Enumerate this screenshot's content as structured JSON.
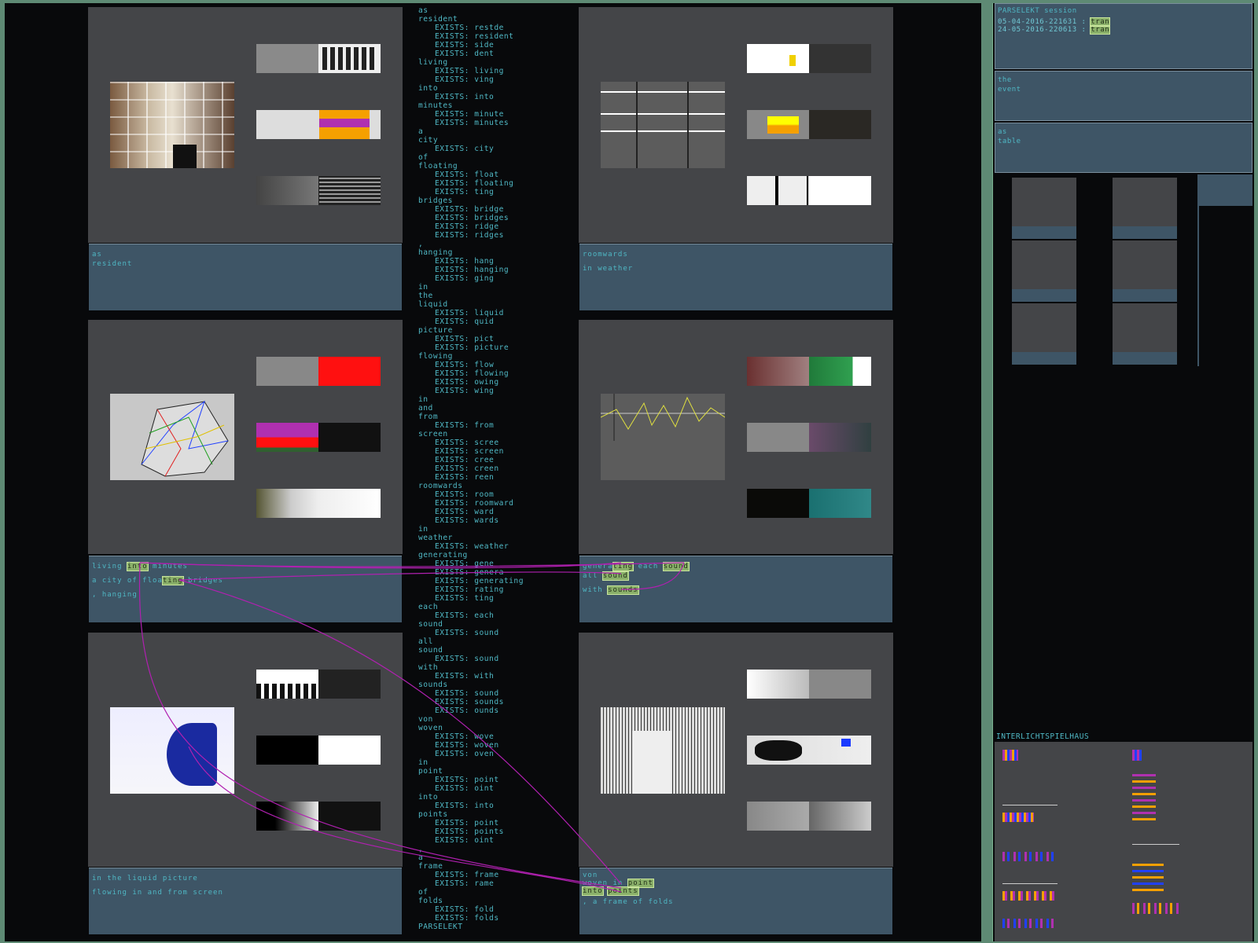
{
  "captions": {
    "p1": [
      "as",
      "resident"
    ],
    "p2": [
      "roomwards",
      "",
      "in weather"
    ],
    "p3": {
      "line1": [
        "living ",
        "into",
        " minutes"
      ],
      "line2": [
        "a city of floa",
        "ting",
        " bridges"
      ],
      "line3": ", hanging"
    },
    "p4": {
      "line1": [
        "genera",
        "ting",
        " each ",
        "sound"
      ],
      "line2": [
        "all ",
        "sound"
      ],
      "line3": [
        "with ",
        "sounds"
      ]
    },
    "p5": [
      "in the liquid picture",
      "flowing in and from screen"
    ],
    "p6": {
      "line1": [
        "von"
      ],
      "line2": [
        "woven in ",
        "point"
      ],
      "line3": [
        "into",
        " ",
        "points"
      ],
      "line4": ", a frame of folds"
    }
  },
  "wordlist": [
    [
      "as",
      []
    ],
    [
      "resident",
      [
        "restde",
        "resident",
        "side",
        "dent"
      ]
    ],
    [
      "living",
      [
        "living",
        "ving"
      ]
    ],
    [
      "into",
      [
        "into"
      ]
    ],
    [
      "minutes",
      [
        "minute",
        "minutes"
      ]
    ],
    [
      "a",
      []
    ],
    [
      "city",
      [
        "city"
      ]
    ],
    [
      "of",
      []
    ],
    [
      "floating",
      [
        "float",
        "floating",
        "ting"
      ]
    ],
    [
      "bridges",
      [
        "bridge",
        "bridges",
        "ridge",
        "ridges"
      ]
    ],
    [
      ",",
      []
    ],
    [
      "hanging",
      [
        "hang",
        "hanging",
        "ging"
      ]
    ],
    [
      "in",
      []
    ],
    [
      "the",
      []
    ],
    [
      "liquid",
      [
        "liquid",
        "quid"
      ]
    ],
    [
      "picture",
      [
        "pict",
        "picture"
      ]
    ],
    [
      "flowing",
      [
        "flow",
        "flowing",
        "owing",
        "wing"
      ]
    ],
    [
      "in",
      []
    ],
    [
      "and",
      []
    ],
    [
      "from",
      [
        "from"
      ]
    ],
    [
      "screen",
      [
        "scree",
        "screen",
        "cree",
        "creen",
        "reen"
      ]
    ],
    [
      "roomwards",
      [
        "room",
        "roomward",
        "ward",
        "wards"
      ]
    ],
    [
      "in",
      []
    ],
    [
      "weather",
      [
        "weather"
      ]
    ],
    [
      "generating",
      [
        "gene",
        "genera",
        "generating",
        "rating",
        "ting"
      ]
    ],
    [
      "each",
      [
        "each"
      ]
    ],
    [
      "sound",
      [
        "sound"
      ]
    ],
    [
      "all",
      []
    ],
    [
      "sound",
      [
        "sound"
      ]
    ],
    [
      "with",
      [
        "with"
      ]
    ],
    [
      "sounds",
      [
        "sound",
        "sounds",
        "ounds"
      ]
    ],
    [
      "von",
      []
    ],
    [
      "woven",
      [
        "wove",
        "woven",
        "oven"
      ]
    ],
    [
      "in",
      []
    ],
    [
      "point",
      [
        "point",
        "oint"
      ]
    ],
    [
      "into",
      [
        "into"
      ]
    ],
    [
      "points",
      [
        "point",
        "points",
        "oint"
      ]
    ],
    [
      ",",
      []
    ],
    [
      "a",
      []
    ],
    [
      "frame",
      [
        "frame",
        "rame"
      ]
    ],
    [
      "of",
      []
    ],
    [
      "folds",
      [
        "fold",
        "folds"
      ]
    ],
    [
      "PARSELEKT",
      []
    ]
  ],
  "exists_label": "EXISTS:",
  "sidebar": {
    "header_title": "PARSELEKT session",
    "sessions": [
      {
        "label": "05-04-2016-221631 : ",
        "badge": "tran"
      },
      {
        "label": "24-05-2016-220613 : ",
        "badge": "tran"
      }
    ],
    "box2": [
      "the",
      "event"
    ],
    "box3": [
      "as",
      "table"
    ],
    "section_title": "INTERLICHTSPIELHAUS"
  },
  "colors": {
    "text": "#4fb7c4",
    "panel": "#444548",
    "caption": "#3e5566",
    "highlight": "#8ab06a",
    "link": "#b020b0"
  }
}
